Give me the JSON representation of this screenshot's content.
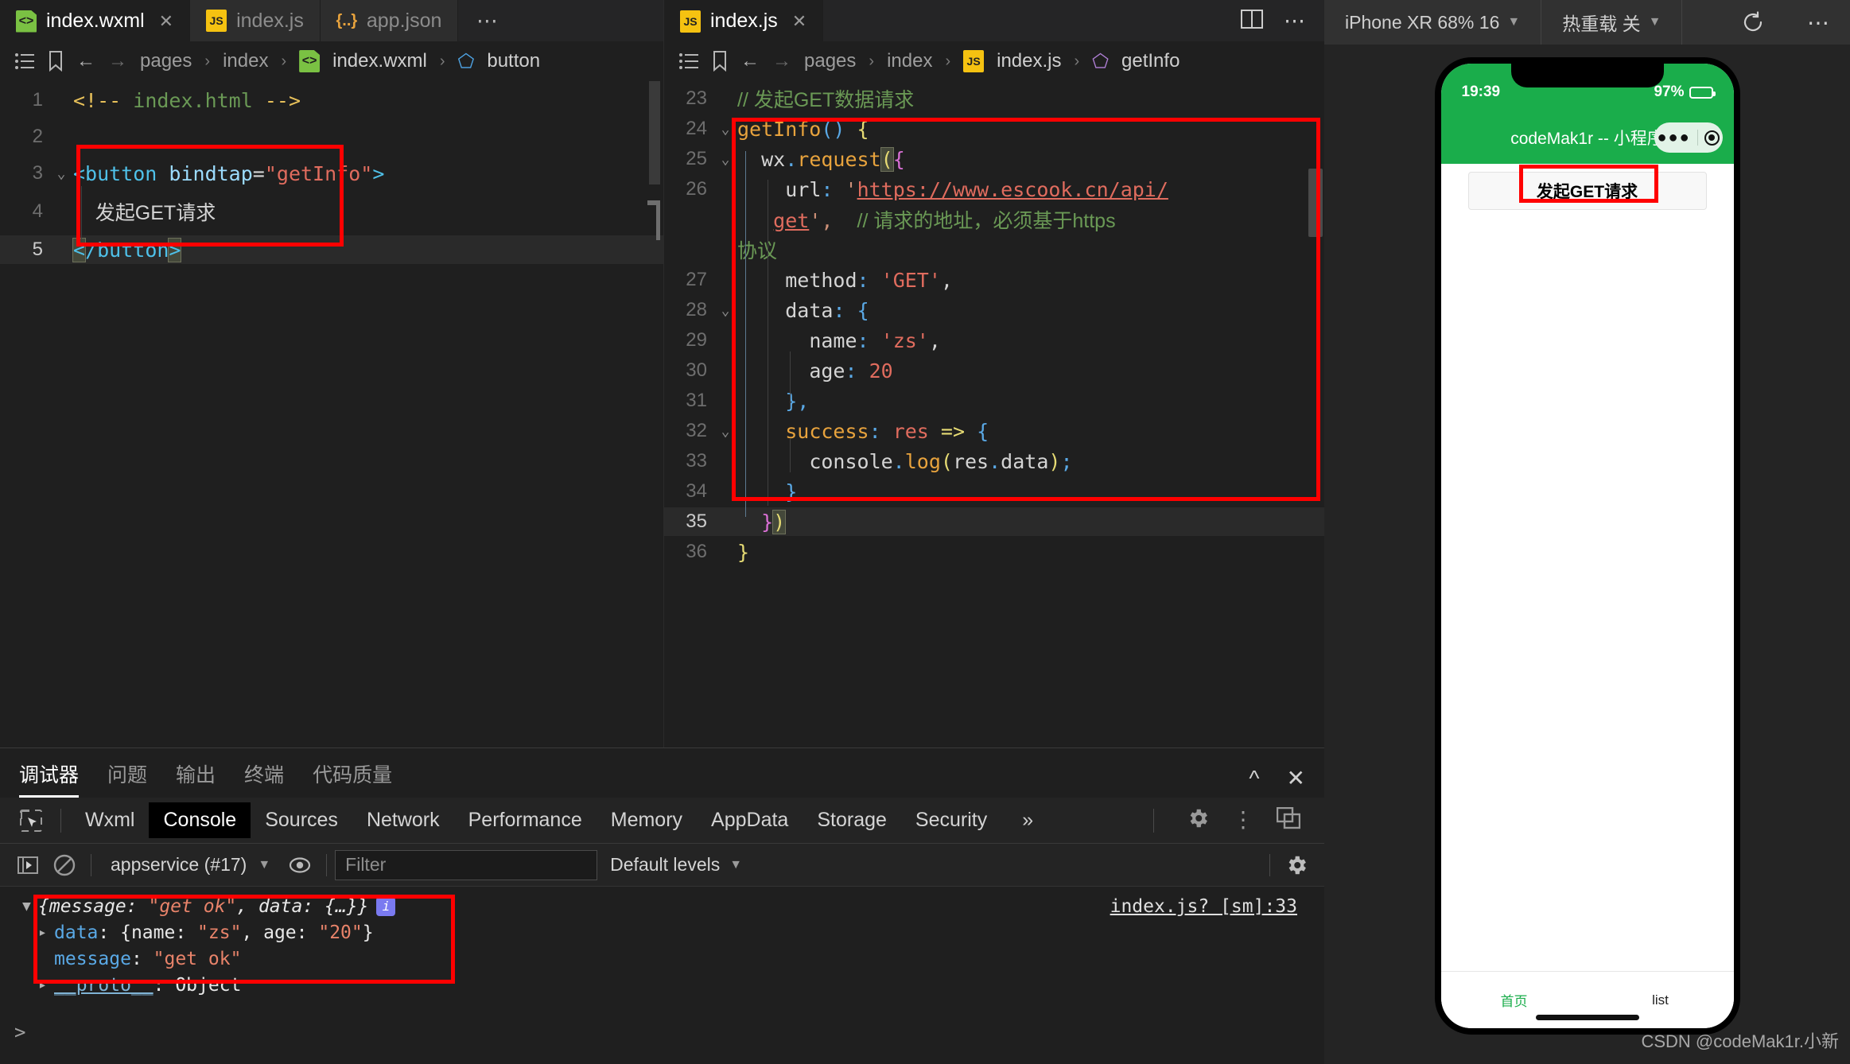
{
  "left_editor": {
    "tabs": [
      {
        "label": "index.wxml",
        "icon": "wxml-file-icon",
        "active": true,
        "closable": true
      },
      {
        "label": "index.js",
        "icon": "js-file-icon",
        "active": false,
        "closable": false
      },
      {
        "label": "app.json",
        "icon": "json-file-icon",
        "active": false,
        "closable": false
      }
    ],
    "overflow_label": "⋯",
    "breadcrumb": [
      "pages",
      "index",
      "index.wxml",
      "button"
    ],
    "lines": [
      {
        "num": "1",
        "fold": "",
        "text": "<!-- index.html -->"
      },
      {
        "num": "2",
        "fold": "",
        "text": ""
      },
      {
        "num": "3",
        "fold": "⌄",
        "text": "<button bindtap=\"getInfo\">"
      },
      {
        "num": "4",
        "fold": "",
        "text": "  发起GET请求"
      },
      {
        "num": "5",
        "fold": "",
        "text": "</button>"
      }
    ]
  },
  "right_editor": {
    "tabs": [
      {
        "label": "index.js",
        "icon": "js-file-icon",
        "active": true,
        "closable": true
      }
    ],
    "split_icon": "split-editor-icon",
    "more_icon": "more-actions-icon",
    "breadcrumb": [
      "pages",
      "index",
      "index.js",
      "getInfo"
    ],
    "lines": [
      {
        "num": "23",
        "fold": "",
        "text": "// 发起GET数据请求"
      },
      {
        "num": "24",
        "fold": "⌄",
        "text": "getInfo() {"
      },
      {
        "num": "25",
        "fold": "⌄",
        "text": "  wx.request({"
      },
      {
        "num": "26",
        "fold": "",
        "text": "    url: 'https://www.escook.cn/api/get',  // 请求的地址，必须基于https协议"
      },
      {
        "num": "27",
        "fold": "",
        "text": "    method: 'GET',"
      },
      {
        "num": "28",
        "fold": "⌄",
        "text": "    data: {"
      },
      {
        "num": "29",
        "fold": "",
        "text": "      name: 'zs',"
      },
      {
        "num": "30",
        "fold": "",
        "text": "      age: 20"
      },
      {
        "num": "31",
        "fold": "",
        "text": "    },"
      },
      {
        "num": "32",
        "fold": "⌄",
        "text": "    success: res => {"
      },
      {
        "num": "33",
        "fold": "",
        "text": "      console.log(res.data);"
      },
      {
        "num": "34",
        "fold": "",
        "text": "    }"
      },
      {
        "num": "35",
        "fold": "",
        "text": "  })"
      },
      {
        "num": "36",
        "fold": "",
        "text": "}"
      }
    ],
    "wrapped": {
      "url_part1": "url: 'https://www.escook.cn/api/",
      "url_part2": "get',  // 请求的地址，必须基于https",
      "url_part3": "协议"
    }
  },
  "devtools": {
    "panel_tabs": [
      {
        "label": "调试器",
        "active": true
      },
      {
        "label": "问题",
        "active": false
      },
      {
        "label": "输出",
        "active": false
      },
      {
        "label": "终端",
        "active": false
      },
      {
        "label": "代码质量",
        "active": false
      }
    ],
    "panel_collapse_icon": "chevron-up-icon",
    "panel_close_icon": "close-icon",
    "sub_tabs": [
      {
        "label": "Wxml",
        "active": false
      },
      {
        "label": "Console",
        "active": true
      },
      {
        "label": "Sources",
        "active": false
      },
      {
        "label": "Network",
        "active": false
      },
      {
        "label": "Performance",
        "active": false
      },
      {
        "label": "Memory",
        "active": false
      },
      {
        "label": "AppData",
        "active": false
      },
      {
        "label": "Storage",
        "active": false
      },
      {
        "label": "Security",
        "active": false
      }
    ],
    "sub_tabs_more": "»",
    "sub_right_icons": [
      "settings-gear-icon",
      "more-vertical-icon",
      "dock-panel-icon"
    ],
    "console_toolbar": {
      "execute_icon": "execute-step-icon",
      "clear_icon": "clear-console-icon",
      "context": "appservice (#17)",
      "eye_icon": "live-expression-icon",
      "filter_placeholder": "Filter",
      "filter_value": "",
      "levels": "Default levels",
      "settings_icon": "settings-gear-icon"
    },
    "console_log": {
      "summary_prefix": "{message: ",
      "summary_str": "\"get ok\"",
      "summary_mid": ", data: {…}}",
      "badge": "i",
      "rows": [
        {
          "indent": 1,
          "arrow": "▸",
          "key": "data",
          "sep": ": ",
          "value": "{name: \"zs\", age: \"20\"}"
        },
        {
          "indent": 1,
          "arrow": "",
          "key": "message",
          "sep": ": ",
          "value": "\"get ok\""
        },
        {
          "indent": 1,
          "arrow": "▸",
          "key": "__proto__",
          "sep": ": ",
          "value": "Object"
        }
      ],
      "source_link": "index.js? [sm]:33",
      "prompt": ">"
    }
  },
  "simulator": {
    "device_select": "iPhone XR 68% 16",
    "hotreload_select": "热重载 关",
    "refresh_icon": "refresh-icon",
    "more_icon": "more-actions-icon",
    "phone": {
      "status_time": "19:39",
      "battery_percent": "97%",
      "nav_title": "codeMak1r -- 小程序",
      "capsule_more_icon": "capsule-more-icon",
      "capsule_target_icon": "capsule-target-icon",
      "button_label": "发起GET请求",
      "tabbar": [
        {
          "label": "首页",
          "active": true
        },
        {
          "label": "list",
          "active": false
        }
      ]
    },
    "watermark": "CSDN @codeMak1r.小新"
  },
  "colors": {
    "accent_green": "#1aad4b",
    "highlight_red": "#ff0000",
    "editor_bg": "#1f1f1f"
  }
}
